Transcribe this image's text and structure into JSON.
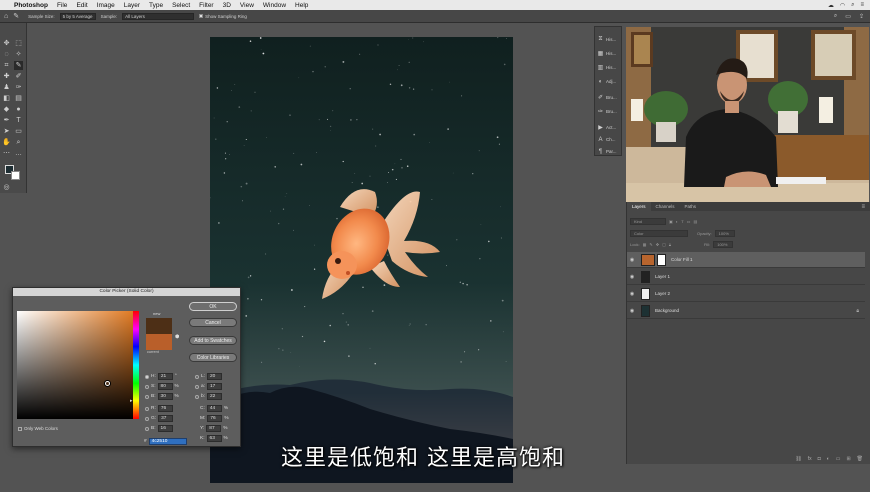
{
  "menubar": {
    "app": "Photoshop",
    "items": [
      "File",
      "Edit",
      "Image",
      "Layer",
      "Type",
      "Select",
      "Filter",
      "3D",
      "View",
      "Window",
      "Help"
    ]
  },
  "options_bar": {
    "sample_size_label": "Sample Size:",
    "sample_size_value": "5 by 5 Average",
    "sample_label": "Sample:",
    "sample_value": "All Layers",
    "show_ring_label": "Show Sampling Ring"
  },
  "mini_panels": [
    {
      "icon": "history-icon",
      "label": "His..."
    },
    {
      "icon": "histogram-icon",
      "label": "His..."
    },
    {
      "icon": "histogram-icon",
      "label": "His..."
    },
    {
      "icon": "adjustments-icon",
      "label": "Adj..."
    },
    {
      "icon": "brush-icon",
      "label": "Bru..."
    },
    {
      "icon": "brush-settings-icon",
      "label": "Bru..."
    },
    {
      "icon": "actions-icon",
      "label": "Act..."
    },
    {
      "icon": "character-icon",
      "label": "Ch..."
    },
    {
      "icon": "paragraph-icon",
      "label": "Par..."
    }
  ],
  "layers_panel": {
    "tabs": [
      "Layers",
      "Channels",
      "Paths"
    ],
    "filter_kind": "Kind",
    "blend_mode": "Color",
    "opacity_label": "Opacity:",
    "opacity_value": "100%",
    "lock_label": "Lock:",
    "fill_label": "Fill:",
    "fill_value": "100%",
    "layers": [
      {
        "name": "Color Fill 1",
        "selected": true,
        "thumb": "#b8652e"
      },
      {
        "name": "Layer 1",
        "selected": false,
        "thumb": "#222"
      },
      {
        "name": "Layer 2",
        "selected": false,
        "thumb": "#eee"
      },
      {
        "name": "Background",
        "selected": false,
        "thumb": "#1d3133"
      }
    ]
  },
  "color_picker": {
    "title": "Color Picker (Solid Color)",
    "ok": "OK",
    "cancel": "Cancel",
    "add_swatches": "Add to Swatches",
    "color_libraries": "Color Libraries",
    "new_label": "new",
    "current_label": "current",
    "only_web": "Only Web Colors",
    "fields": {
      "H": "21",
      "S": "80",
      "B": "30",
      "R": "76",
      "G": "37",
      "Bl": "16",
      "L": "20",
      "a": "17",
      "b": "22",
      "C": "44",
      "M": "76",
      "Y": "87",
      "K": "63"
    },
    "units": {
      "H": "°",
      "S": "%",
      "B": "%",
      "C": "%",
      "M": "%",
      "Y": "%",
      "K": "%"
    },
    "hex": "4c2510",
    "new_color": "#4c2510",
    "current_color": "#b95f2a"
  },
  "subtitle": "这里是低饱和 这里是高饱和"
}
